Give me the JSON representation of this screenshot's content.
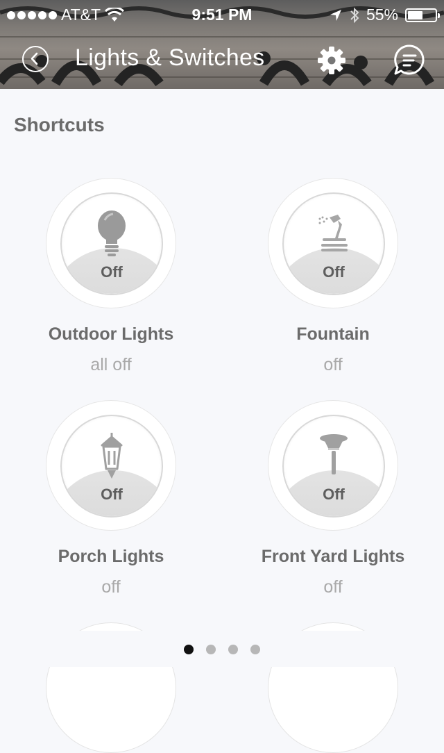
{
  "status_bar": {
    "carrier": "AT&T",
    "time": "9:51 PM",
    "battery_text": "55%",
    "battery_level": 0.55
  },
  "nav": {
    "title": "Lights & Switches",
    "icons": [
      "back-icon",
      "gear-icon",
      "chat-icon"
    ]
  },
  "section": {
    "title": "Shortcuts"
  },
  "shortcuts": [
    {
      "name": "Outdoor Lights",
      "state_label": "Off",
      "status": "all off",
      "icon": "lightbulb-icon"
    },
    {
      "name": "Fountain",
      "state_label": "Off",
      "status": "off",
      "icon": "fountain-icon"
    },
    {
      "name": "Porch Lights",
      "state_label": "Off",
      "status": "off",
      "icon": "porch-lantern-icon"
    },
    {
      "name": "Front Yard Lights",
      "state_label": "Off",
      "status": "off",
      "icon": "yard-light-icon"
    }
  ],
  "pager": {
    "pages": 4,
    "active": 1
  },
  "colors": {
    "accent": "#ffffff",
    "text_primary": "#6b6b6b",
    "text_secondary": "#a9a9a9",
    "off_cap": "#d6d6d6"
  }
}
